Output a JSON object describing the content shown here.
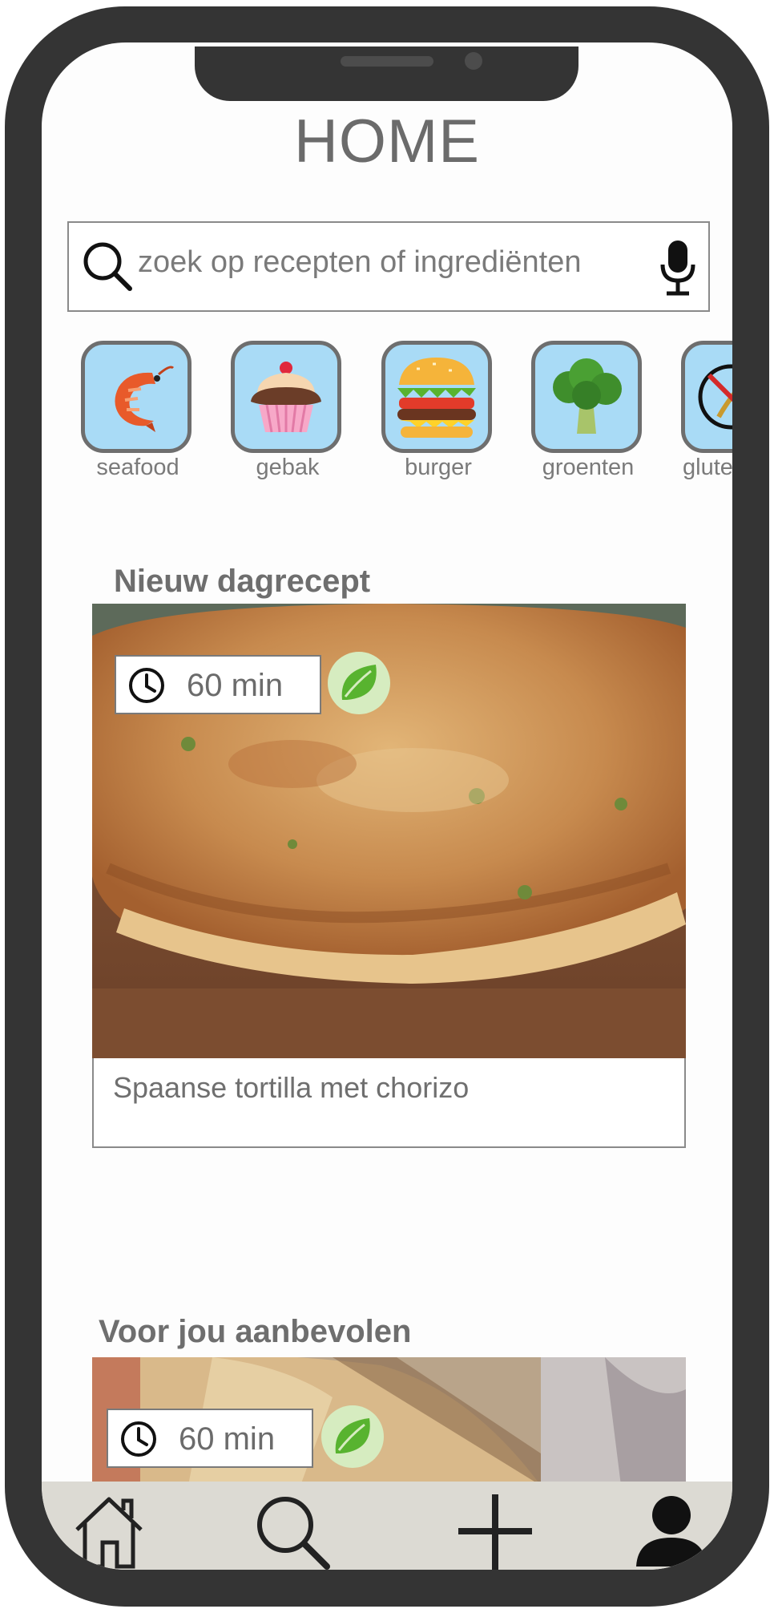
{
  "header": {
    "title": "HOME"
  },
  "search": {
    "placeholder": "zoek op recepten of ingrediënten",
    "search_icon": "search-icon",
    "mic_icon": "microphone-icon"
  },
  "categories": [
    {
      "label": "seafood",
      "icon": "shrimp-icon"
    },
    {
      "label": "gebak",
      "icon": "cupcake-icon"
    },
    {
      "label": "burger",
      "icon": "burger-icon"
    },
    {
      "label": "groenten",
      "icon": "broccoli-icon"
    },
    {
      "label": "glute",
      "icon": "gluten-free-icon"
    }
  ],
  "daily_recipe": {
    "section_title": "Nieuw dagrecept",
    "time": "60 min",
    "badge_icon": "leaf-icon",
    "name": "Spaanse tortilla met chorizo"
  },
  "recommended": {
    "section_title": "Voor jou aanbevolen",
    "time": "60 min",
    "badge_icon": "leaf-icon"
  },
  "tabbar": {
    "items": [
      {
        "name": "home",
        "icon": "home-icon"
      },
      {
        "name": "search",
        "icon": "search-icon"
      },
      {
        "name": "add",
        "icon": "plus-icon"
      },
      {
        "name": "profile",
        "icon": "user-icon"
      }
    ]
  },
  "colors": {
    "frame": "#343434",
    "category_tile": "#a9dbf6",
    "leaf_badge": "#d6ecc0",
    "tabbar": "#dcdad3",
    "text_gray": "#6e6e6e"
  }
}
